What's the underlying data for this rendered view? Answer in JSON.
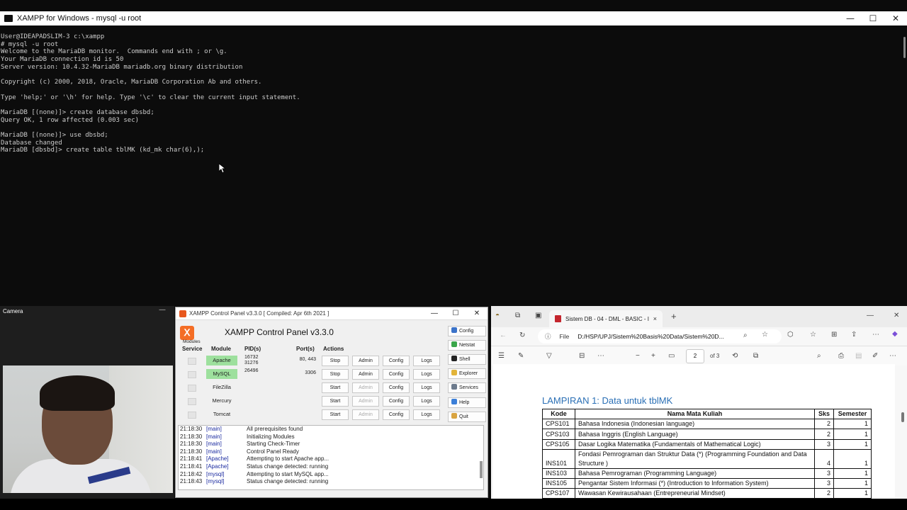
{
  "terminal": {
    "title": "XAMPP for Windows - mysql  -u root",
    "lines": [
      "User@IDEAPADSLIM-3 c:\\xampp",
      "# mysql -u root",
      "Welcome to the MariaDB monitor.  Commands end with ; or \\g.",
      "Your MariaDB connection id is 50",
      "Server version: 10.4.32-MariaDB mariadb.org binary distribution",
      "",
      "Copyright (c) 2000, 2018, Oracle, MariaDB Corporation Ab and others.",
      "",
      "Type 'help;' or '\\h' for help. Type '\\c' to clear the current input statement.",
      "",
      "MariaDB [(none)]> create database dbsbd;",
      "Query OK, 1 row affected (0.003 sec)",
      "",
      "MariaDB [(none)]> use dbsbd;",
      "Database changed",
      "MariaDB [dbsbd]> create table tblMK (kd_mk char(6),);"
    ]
  },
  "camera": {
    "title": "Camera",
    "minimize": "—"
  },
  "xampp": {
    "title": "XAMPP Control Panel v3.3.0   [ Compiled: Apr 6th 2021 ]",
    "heading": "XAMPP Control Panel v3.3.0",
    "logo": "ꓫ",
    "modules_label": "Modules",
    "headers": {
      "service": "Service",
      "module": "Module",
      "pid": "PID(s)",
      "port": "Port(s)",
      "actions": "Actions"
    },
    "rows": [
      {
        "module": "Apache",
        "pid": "16732\n31276",
        "port": "80, 443",
        "action": "Stop",
        "admin": "Admin",
        "config": "Config",
        "logs": "Logs",
        "running": true
      },
      {
        "module": "MySQL",
        "pid": "26496",
        "port": "3306",
        "action": "Stop",
        "admin": "Admin",
        "config": "Config",
        "logs": "Logs",
        "running": true
      },
      {
        "module": "FileZilla",
        "pid": "",
        "port": "",
        "action": "Start",
        "admin": "Admin",
        "config": "Config",
        "logs": "Logs",
        "running": false
      },
      {
        "module": "Mercury",
        "pid": "",
        "port": "",
        "action": "Start",
        "admin": "Admin",
        "config": "Config",
        "logs": "Logs",
        "running": false
      },
      {
        "module": "Tomcat",
        "pid": "",
        "port": "",
        "action": "Start",
        "admin": "Admin",
        "config": "Config",
        "logs": "Logs",
        "running": false
      }
    ],
    "side_buttons": [
      {
        "label": "Config",
        "color": "#3b73c9"
      },
      {
        "label": "Netstat",
        "color": "#3aa64a"
      },
      {
        "label": "Shell",
        "color": "#222222"
      },
      {
        "label": "Explorer",
        "color": "#e2b43a"
      },
      {
        "label": "Services",
        "color": "#6c7a8c"
      },
      {
        "label": "Help",
        "color": "#3b7fd8"
      },
      {
        "label": "Quit",
        "color": "#d9a441"
      }
    ],
    "log": [
      {
        "time": "21:18:30",
        "module": "[main]",
        "message": "All prerequisites found"
      },
      {
        "time": "21:18:30",
        "module": "[main]",
        "message": "Initializing Modules"
      },
      {
        "time": "21:18:30",
        "module": "[main]",
        "message": "Starting Check-Timer"
      },
      {
        "time": "21:18:30",
        "module": "[main]",
        "message": "Control Panel Ready"
      },
      {
        "time": "21:18:41",
        "module": "[Apache]",
        "message": "Attempting to start Apache app..."
      },
      {
        "time": "21:18:41",
        "module": "[Apache]",
        "message": "Status change detected: running"
      },
      {
        "time": "21:18:42",
        "module": "[mysql]",
        "message": "Attempting to start MySQL app..."
      },
      {
        "time": "21:18:43",
        "module": "[mysql]",
        "message": "Status change detected: running"
      }
    ]
  },
  "browser": {
    "tab_title": "Sistem DB - 04 - DML - BASIC - I",
    "tab_close": "×",
    "new_tab": "+",
    "address_label": "File",
    "address": "D:/HSP/UPJ/Sistem%20Basis%20Data/Sistem%20D...",
    "page_current": "2",
    "page_total": "of 3",
    "pdf_heading": "LAMPIRAN 1: Data untuk tblMK",
    "table_headers": [
      "Kode",
      "Nama Mata Kuliah",
      "Sks",
      "Semester"
    ],
    "table_rows": [
      [
        "CPS101",
        "Bahasa Indonesia (Indonesian language)",
        "2",
        "1"
      ],
      [
        "CPS103",
        "Bahasa Inggris (English Language)",
        "2",
        "1"
      ],
      [
        "CPS105",
        "Dasar Logika Matematika (Fundamentals of Mathematical Logic)",
        "3",
        "1"
      ],
      [
        "INS101",
        "Fondasi Pemrograman dan Struktur Data (*) (Programming Foundation and Data Structure )",
        "4",
        "1"
      ],
      [
        "INS103",
        "Bahasa Pemrograman (Programming Language)",
        "3",
        "1"
      ],
      [
        "INS105",
        "Pengantar Sistem Informasi (*) (Introduction to Information System)",
        "3",
        "1"
      ],
      [
        "CPS107",
        "Wawasan Kewirausahaan  (Entrepreneurial Mindset)",
        "2",
        "1"
      ]
    ]
  }
}
